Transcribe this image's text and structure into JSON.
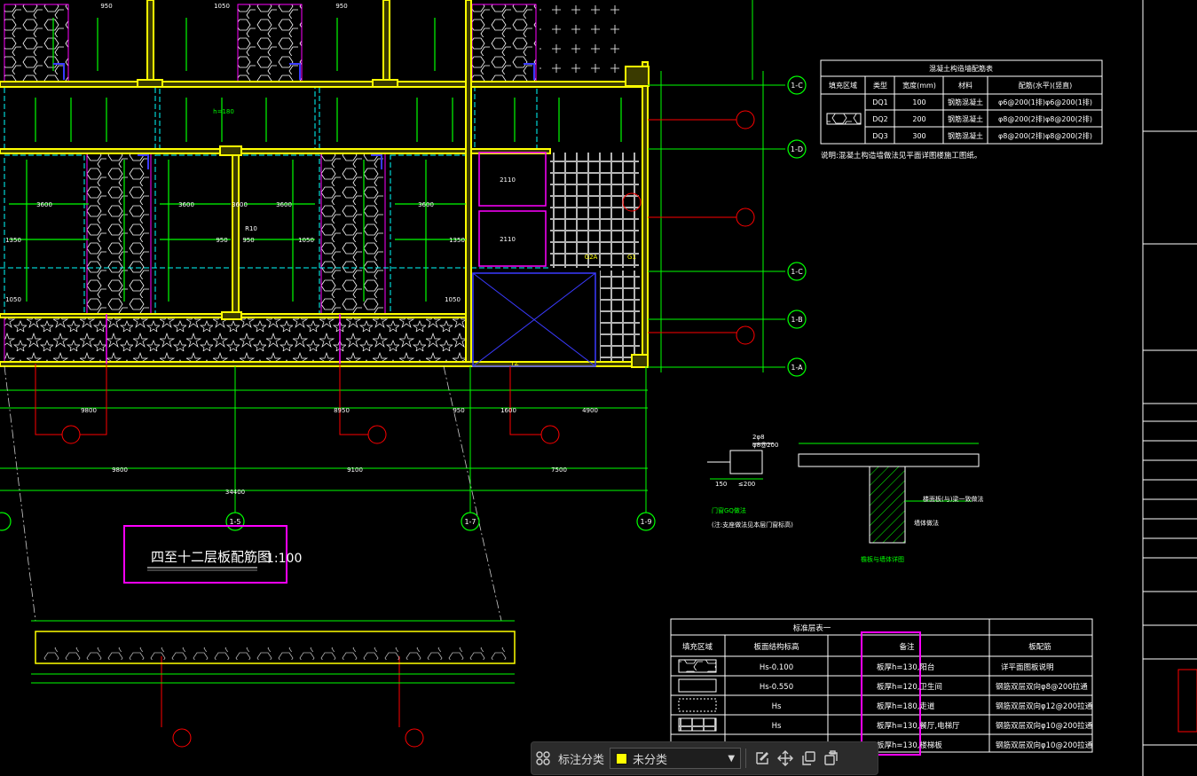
{
  "drawing": {
    "title": "四至十二层板配筋图",
    "scale": "1:100",
    "grid_labels": [
      "1-C",
      "1-D",
      "1-C",
      "1-B",
      "1-A",
      "1-5",
      "1-7",
      "1-9"
    ],
    "dims_bottom": [
      "9800",
      "8950",
      "950",
      "1600",
      "4900"
    ],
    "dims_total": [
      "9800",
      "9100",
      "7500",
      "34400"
    ],
    "dims_room": [
      "3600",
      "3600",
      "3600",
      "3600"
    ],
    "dims_misc": [
      "1350",
      "950",
      "950",
      "1050",
      "1050",
      "1350",
      "950",
      "1050",
      "950",
      "1050",
      "3600",
      "2110",
      "2110"
    ]
  },
  "table_top": {
    "title": "混凝土构造墙配筋表",
    "headers": [
      "填充区域",
      "类型",
      "宽度(mm)",
      "材料",
      "配筋(水平)(竖直)"
    ],
    "rows": [
      [
        "DQ1",
        "100",
        "钢筋混凝土",
        "φ6@200(1排)φ6@200(1排)"
      ],
      [
        "DQ2",
        "200",
        "钢筋混凝土",
        "φ8@200(2排)φ8@200(2排)"
      ],
      [
        "DQ3",
        "300",
        "钢筋混凝土",
        "φ8@200(2排)φ8@200(2排)"
      ]
    ],
    "note": "说明:混凝土构造墙做法见平面详图楼施工图纸。"
  },
  "table_bottom": {
    "title": "标准层表一",
    "headers": [
      "填充区域",
      "板面结构标高",
      "备注",
      "板配筋"
    ],
    "rows": [
      [
        "Hs-0.100",
        "板厚h=130,阳台",
        "详平面图板说明"
      ],
      [
        "Hs-0.550",
        "板厚h=120,卫生间",
        "钢筋双层双向φ8@200拉通"
      ],
      [
        "Hs",
        "板厚h=180,走道",
        "钢筋双层双向φ12@200拉通"
      ],
      [
        "Hs",
        "板厚h=130,餐厅,电梯厅",
        "钢筋双层双向φ10@200拉通"
      ],
      [
        "Hs",
        "板厚h=130,楼梯板",
        "钢筋双层双向φ10@200拉通"
      ]
    ]
  },
  "details": {
    "door_label": "门窗GQ做法",
    "door_note": "(注:支座做法见本层门窗标高)",
    "wall_label": "檐板与墙体详图",
    "wall_note": "墙体做法",
    "beam_note": "楼面板(与)梁一致做法"
  },
  "annotations": {
    "h180": "h=180",
    "dim_150": "150",
    "dim_200": "≤200",
    "dim_2b": "2φ8",
    "dim_600": "φ8@200",
    "tz": "TZ",
    "g2a": "G2A",
    "g1": "G1",
    "r10": "R10"
  },
  "toolbar": {
    "label": "标注分类",
    "selected": "未分类",
    "swatch_color": "#ffff00"
  },
  "colors": {
    "green": "#00ff00",
    "yellow": "#ffff00",
    "cyan": "#00ffff",
    "magenta": "#ff00ff",
    "red": "#ff0000",
    "blue": "#3a3aff",
    "white": "#ffffff"
  }
}
